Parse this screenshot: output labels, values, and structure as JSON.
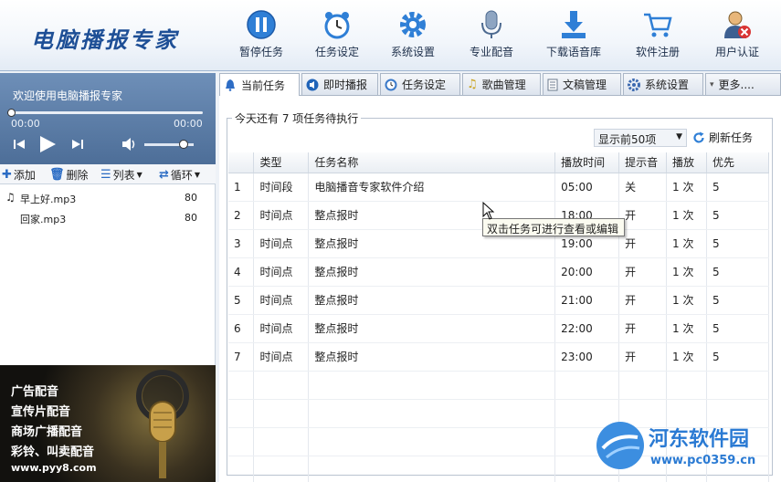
{
  "app": {
    "logo_text": "电脑播报专家"
  },
  "toolbar": {
    "buttons": [
      {
        "label": "暂停任务",
        "icon": "pause-icon"
      },
      {
        "label": "任务设定",
        "icon": "alarm-clock-icon"
      },
      {
        "label": "系统设置",
        "icon": "gear-icon"
      },
      {
        "label": "专业配音",
        "icon": "microphone-icon"
      },
      {
        "label": "下载语音库",
        "icon": "download-icon"
      },
      {
        "label": "软件注册",
        "icon": "cart-icon"
      },
      {
        "label": "用户认证",
        "icon": "user-cancel-icon"
      }
    ]
  },
  "player": {
    "welcome": "欢迎使用电脑播报专家",
    "time_current": "00:00",
    "time_total": "00:00",
    "progress": 0.0,
    "volume": 0.8
  },
  "playlist_toolbar": {
    "add": "添加",
    "delete": "删除",
    "list": "列表",
    "loop": "循环"
  },
  "playlist": [
    {
      "name": "早上好.mp3",
      "value": "80",
      "playing": true
    },
    {
      "name": "回家.mp3",
      "value": "80",
      "playing": false
    }
  ],
  "ad_banner": {
    "lines": [
      "广告配音",
      "宣传片配音",
      "商场广播配音",
      "彩铃、叫卖配音"
    ],
    "url": "www.pyy8.com"
  },
  "tabs": [
    {
      "label": "当前任务",
      "active": true,
      "color": "#2e6dc5"
    },
    {
      "label": "即时播报",
      "active": false,
      "color": "#1f63b8"
    },
    {
      "label": "任务设定",
      "active": false,
      "color": "#3a79c9"
    },
    {
      "label": "歌曲管理",
      "active": false,
      "color": "#caa21e"
    },
    {
      "label": "文稿管理",
      "active": false,
      "color": "#6b7a8c"
    },
    {
      "label": "系统设置",
      "active": false,
      "color": "#3d6ab0"
    },
    {
      "label": "更多....",
      "active": false,
      "color": "#7a8595"
    }
  ],
  "task_panel": {
    "title": "今天还有 7 项任务待执行",
    "limit_selected": "显示前50项",
    "refresh": "刷新任务",
    "columns": [
      "",
      "类型",
      "任务名称",
      "播放时间",
      "提示音",
      "播放",
      "优先"
    ],
    "rows": [
      [
        "1",
        "时间段",
        "电脑播音专家软件介绍",
        "05:00",
        "关",
        "1 次",
        "5"
      ],
      [
        "2",
        "时间点",
        "整点报时",
        "18:00",
        "开",
        "1 次",
        "5"
      ],
      [
        "3",
        "时间点",
        "整点报时",
        "19:00",
        "开",
        "1 次",
        "5"
      ],
      [
        "4",
        "时间点",
        "整点报时",
        "20:00",
        "开",
        "1 次",
        "5"
      ],
      [
        "5",
        "时间点",
        "整点报时",
        "21:00",
        "开",
        "1 次",
        "5"
      ],
      [
        "6",
        "时间点",
        "整点报时",
        "22:00",
        "开",
        "1 次",
        "5"
      ],
      [
        "7",
        "时间点",
        "整点报时",
        "23:00",
        "开",
        "1 次",
        "5"
      ]
    ],
    "tooltip": "双击任务可进行查看或编辑"
  },
  "watermark": {
    "text": "河东软件园",
    "url": "www.pc0359.cn"
  }
}
